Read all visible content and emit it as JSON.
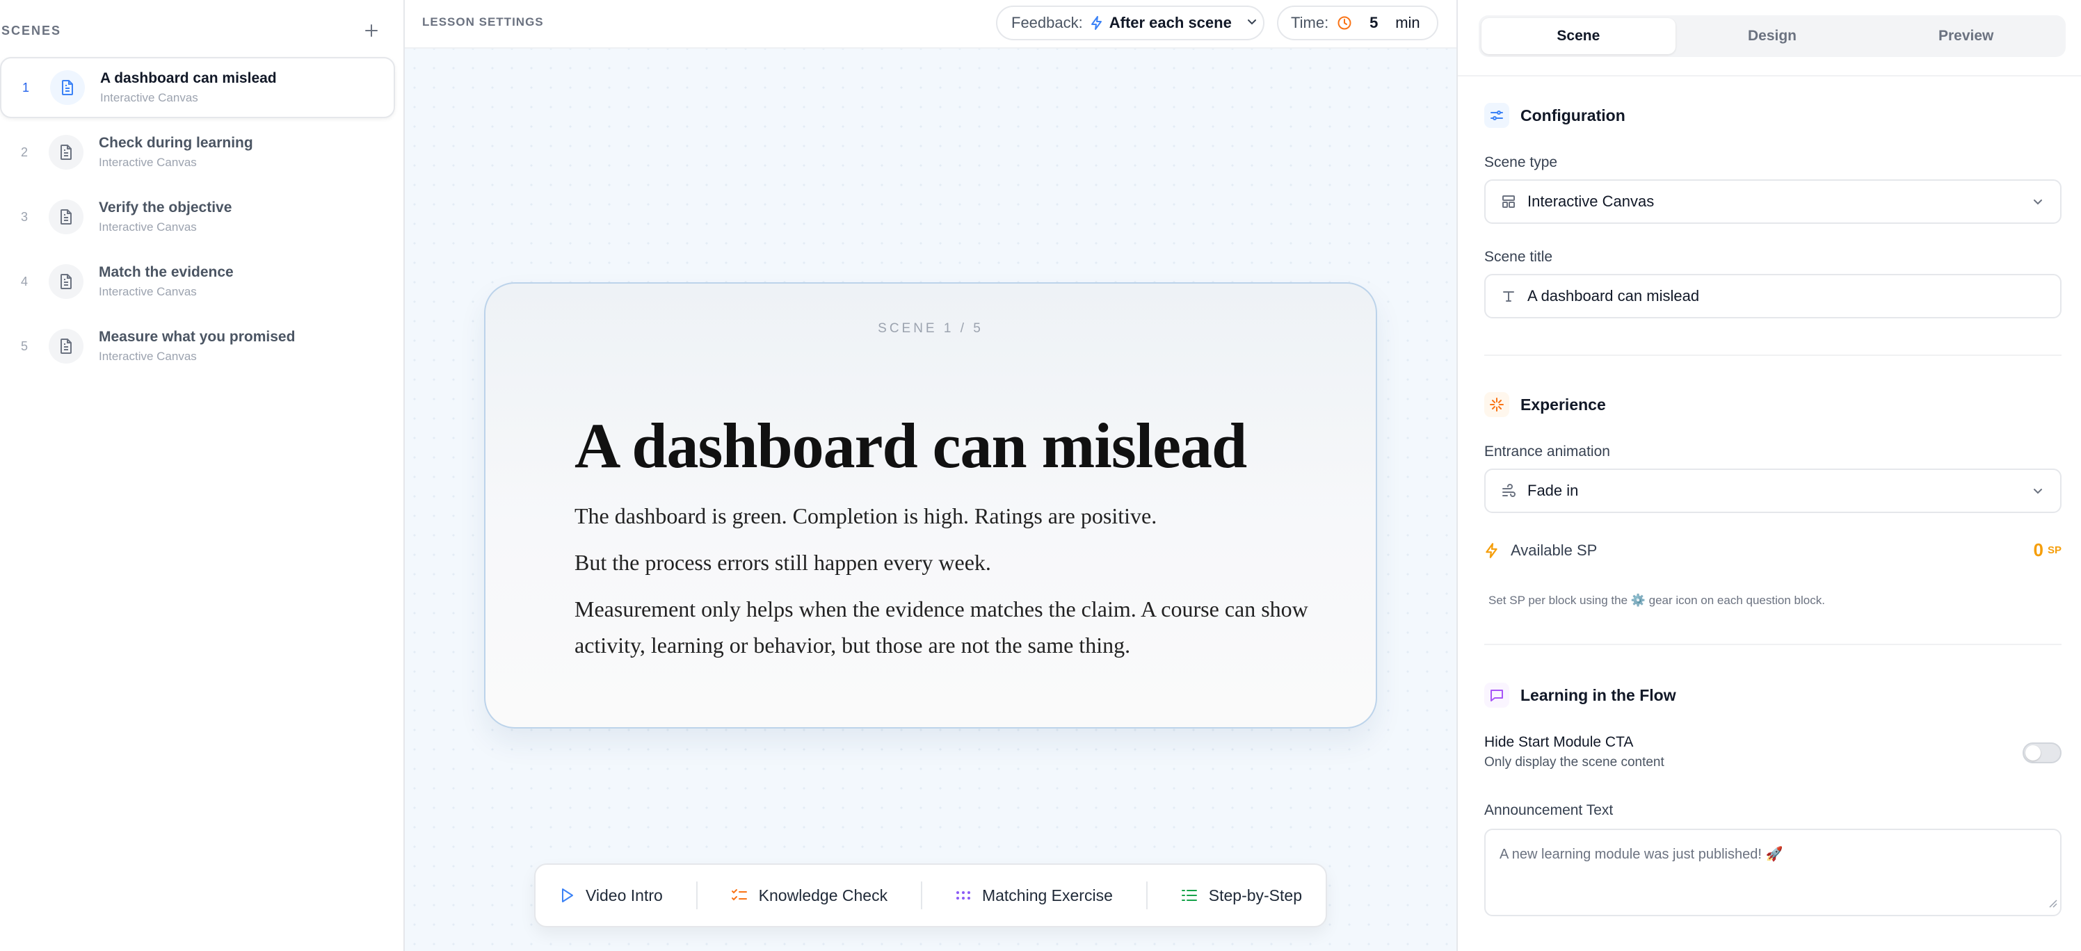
{
  "sidebar": {
    "title": "SCENES",
    "add_icon": "plus-icon",
    "items": [
      {
        "num": "1",
        "name": "A dashboard can mislead",
        "type": "Interactive Canvas",
        "active": true
      },
      {
        "num": "2",
        "name": "Check during learning",
        "type": "Interactive Canvas"
      },
      {
        "num": "3",
        "name": "Verify the objective",
        "type": "Interactive Canvas"
      },
      {
        "num": "4",
        "name": "Match the evidence",
        "type": "Interactive Canvas"
      },
      {
        "num": "5",
        "name": "Measure what you promised",
        "type": "Interactive Canvas"
      }
    ]
  },
  "topbar": {
    "lesson_settings": "LESSON SETTINGS",
    "feedback_label": "Feedback:",
    "feedback_value": "After each scene",
    "time_label": "Time:",
    "time_value": "5",
    "time_unit": "min"
  },
  "scene_card": {
    "counter": "SCENE 1 / 5",
    "title": "A dashboard can mislead",
    "paragraphs": [
      "The dashboard is green. Completion is high. Ratings are positive.",
      "But the process errors still happen every week.",
      "Measurement only helps when the evidence matches the claim. A course can show activity, learning or behavior, but those are not the same thing."
    ]
  },
  "block_toolbar": {
    "video_intro": "Video Intro",
    "knowledge_check": "Knowledge Check",
    "matching_exercise": "Matching Exercise",
    "step_by_step": "Step-by-Step"
  },
  "panel": {
    "tabs": [
      "Scene",
      "Design",
      "Preview"
    ],
    "configuration": {
      "heading": "Configuration",
      "scene_type_label": "Scene type",
      "scene_type_value": "Interactive Canvas",
      "scene_title_label": "Scene title",
      "scene_title_value": "A dashboard can mislead"
    },
    "experience": {
      "heading": "Experience",
      "entrance_label": "Entrance animation",
      "entrance_value": "Fade in",
      "available_sp_label": "Available SP",
      "available_sp_value": "0",
      "available_sp_unit": "SP",
      "hint": "Set SP per block using the ⚙️ gear icon on each question block."
    },
    "flow": {
      "heading": "Learning in the Flow",
      "hide_cta_title": "Hide Start Module CTA",
      "hide_cta_sub": "Only display the scene content",
      "hide_cta_enabled": false,
      "announcement_label": "Announcement Text",
      "announcement_placeholder": "A new learning module was just published! 🚀"
    }
  },
  "colors": {
    "accent_blue": "#2563eb",
    "sp_orange": "#f59e0b",
    "flow_purple": "#a855f7"
  }
}
